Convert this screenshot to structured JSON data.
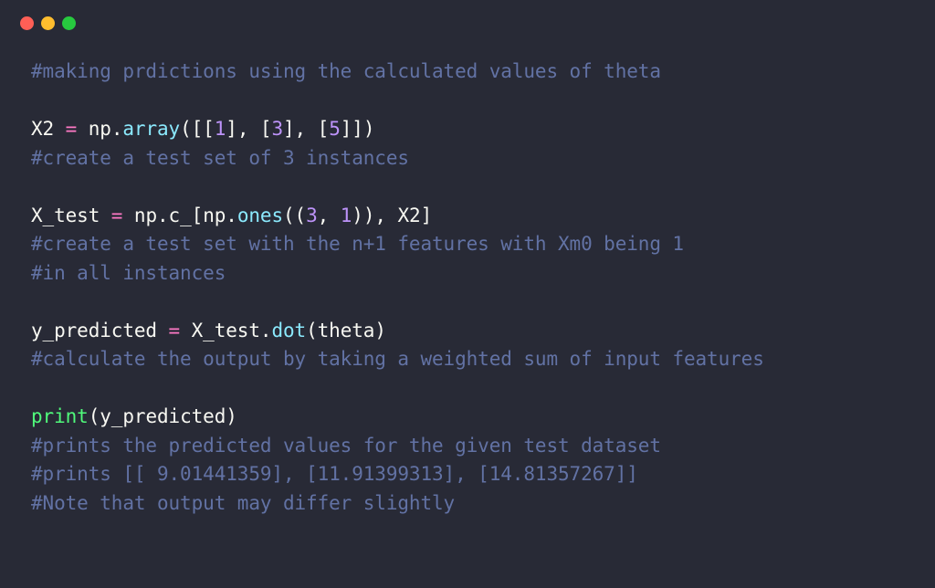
{
  "traffic": {
    "red": "#ff5f56",
    "yellow": "#ffbd2e",
    "green": "#27c93f"
  },
  "syntax": {
    "bg": "#282a36",
    "comment": "#6272a4",
    "fg": "#f8f8f2",
    "pink": "#ff79c6",
    "cyan": "#8be9fd",
    "green": "#50fa7b",
    "purple": "#bd93f9"
  },
  "code": {
    "line1": "#making prdictions using the calculated values of theta",
    "line3_X2": "X2",
    "line3_eq": " = ",
    "line3_np": "np",
    "line3_dot1": ".",
    "line3_array": "array",
    "line3_open": "([[",
    "line3_1": "1",
    "line3_sep1": "], [",
    "line3_3": "3",
    "line3_sep2": "], [",
    "line3_5": "5",
    "line3_close": "]])",
    "line4": "#create a test set of 3 instances",
    "line6_Xtest": "X_test",
    "line6_eq": " = ",
    "line6_np1": "np",
    "line6_dot1": ".",
    "line6_cu": "c_",
    "line6_punct1": "[",
    "line6_np2": "np",
    "line6_dot2": ".",
    "line6_ones": "ones",
    "line6_punct2": "((",
    "line6_3": "3",
    "line6_sep": ", ",
    "line6_1": "1",
    "line6_punct3": ")), ",
    "line6_X2": "X2",
    "line6_punct4": "]",
    "line7": "#create a test set with the n+1 features with Xm0 being 1",
    "line8": "#in all instances",
    "line10_ypred": "y_predicted",
    "line10_eq": " = ",
    "line10_Xtest": "X_test",
    "line10_dot": ".",
    "line10_dotfn": "dot",
    "line10_open": "(",
    "line10_theta": "theta",
    "line10_close": ")",
    "line11": "#calculate the output by taking a weighted sum of input features",
    "line13_print": "print",
    "line13_open": "(",
    "line13_arg": "y_predicted",
    "line13_close": ")",
    "line14": "#prints the predicted values for the given test dataset",
    "line15": "#prints [[ 9.01441359], [11.91399313], [14.81357267]]",
    "line16": "#Note that output may differ slightly"
  }
}
